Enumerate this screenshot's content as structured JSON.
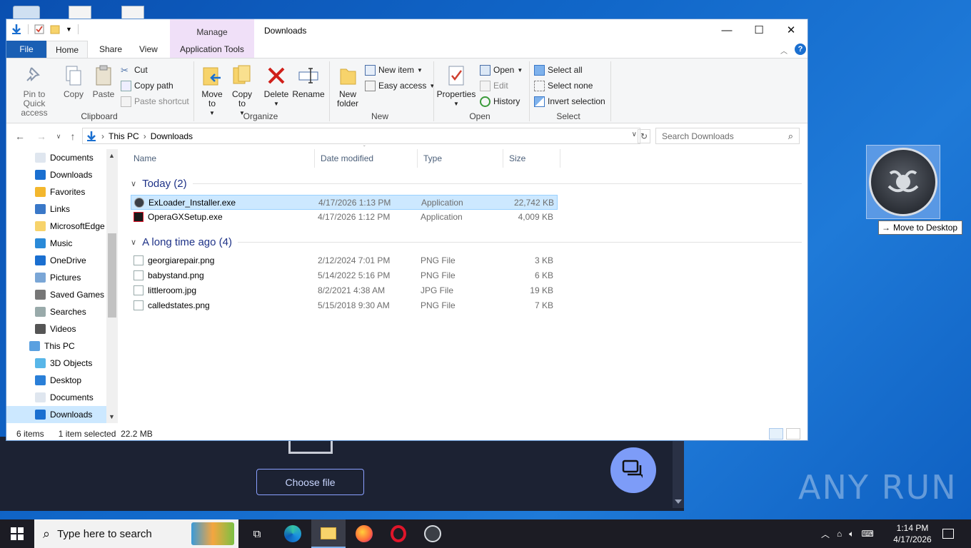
{
  "window": {
    "title": "Downloads",
    "contextual_tab_group": "Manage",
    "controls": {
      "minimize": "—",
      "maximize": "☐",
      "close": "✕"
    }
  },
  "ribbon_tabs": [
    "File",
    "Home",
    "Share",
    "View",
    "Application Tools"
  ],
  "ribbon": {
    "clipboard": {
      "label": "Clipboard",
      "pin": "Pin to Quick access",
      "copy": "Copy",
      "paste": "Paste",
      "cut": "Cut",
      "copy_path": "Copy path",
      "paste_shortcut": "Paste shortcut"
    },
    "organize": {
      "label": "Organize",
      "move_to": "Move to",
      "copy_to": "Copy to",
      "delete": "Delete",
      "rename": "Rename"
    },
    "new": {
      "label": "New",
      "new_folder": "New folder",
      "new_item": "New item",
      "easy_access": "Easy access"
    },
    "open": {
      "label": "Open",
      "properties": "Properties",
      "open": "Open",
      "edit": "Edit",
      "history": "History"
    },
    "select": {
      "label": "Select",
      "select_all": "Select all",
      "select_none": "Select none",
      "invert": "Invert selection"
    }
  },
  "address": {
    "crumbs": [
      "This PC",
      "Downloads"
    ],
    "search_placeholder": "Search Downloads"
  },
  "nav": [
    {
      "label": "Documents",
      "icon": "document-icon",
      "indent": 1
    },
    {
      "label": "Downloads",
      "icon": "download-icon",
      "indent": 1
    },
    {
      "label": "Favorites",
      "icon": "star-icon",
      "indent": 1
    },
    {
      "label": "Links",
      "icon": "link-icon",
      "indent": 1
    },
    {
      "label": "MicrosoftEdge",
      "icon": "folder-icon",
      "indent": 1
    },
    {
      "label": "Music",
      "icon": "music-icon",
      "indent": 1
    },
    {
      "label": "OneDrive",
      "icon": "cloud-icon",
      "indent": 1
    },
    {
      "label": "Pictures",
      "icon": "pictures-icon",
      "indent": 1
    },
    {
      "label": "Saved Games",
      "icon": "games-icon",
      "indent": 1
    },
    {
      "label": "Searches",
      "icon": "search-icon",
      "indent": 1
    },
    {
      "label": "Videos",
      "icon": "video-icon",
      "indent": 1
    },
    {
      "label": "This PC",
      "icon": "computer-icon",
      "indent": 0
    },
    {
      "label": "3D Objects",
      "icon": "cube-icon",
      "indent": 1
    },
    {
      "label": "Desktop",
      "icon": "desktop-icon",
      "indent": 1
    },
    {
      "label": "Documents",
      "icon": "document-icon",
      "indent": 1
    },
    {
      "label": "Downloads",
      "icon": "download-icon",
      "indent": 1,
      "selected": true
    }
  ],
  "columns": [
    "Name",
    "Date modified",
    "Type",
    "Size"
  ],
  "groups": [
    {
      "title": "Today (2)",
      "files": [
        {
          "name": "ExLoader_Installer.exe",
          "date": "4/17/2026 1:13 PM",
          "type": "Application",
          "size": "22,742 KB",
          "icon": "exloader-icon",
          "selected": true
        },
        {
          "name": "OperaGXSetup.exe",
          "date": "4/17/2026 1:12 PM",
          "type": "Application",
          "size": "4,009 KB",
          "icon": "operagx-icon"
        }
      ]
    },
    {
      "title": "A long time ago (4)",
      "files": [
        {
          "name": "georgiarepair.png",
          "date": "2/12/2024 7:01 PM",
          "type": "PNG File",
          "size": "3 KB",
          "icon": "image-file-icon"
        },
        {
          "name": "babystand.png",
          "date": "5/14/2022 5:16 PM",
          "type": "PNG File",
          "size": "6 KB",
          "icon": "image-file-icon"
        },
        {
          "name": "littleroom.jpg",
          "date": "8/2/2021 4:38 AM",
          "type": "JPG File",
          "size": "19 KB",
          "icon": "image-file-icon"
        },
        {
          "name": "calledstates.png",
          "date": "5/15/2018 9:30 AM",
          "type": "PNG File",
          "size": "7 KB",
          "icon": "image-file-icon"
        }
      ]
    }
  ],
  "status": {
    "items": "6 items",
    "selection": "1 item selected  22.2 MB"
  },
  "drag": {
    "tooltip": "Move to Desktop"
  },
  "background_app": {
    "choose_file": "Choose file"
  },
  "watermark": "ANY RUN",
  "taskbar": {
    "search_placeholder": "Type here to search",
    "time": "1:14 PM",
    "date": "4/17/2026"
  },
  "colors": {
    "accent": "#1a5fb4",
    "selection": "#cce8ff",
    "group_heading": "#1e3287",
    "manage_tab": "#f0e0f8"
  }
}
